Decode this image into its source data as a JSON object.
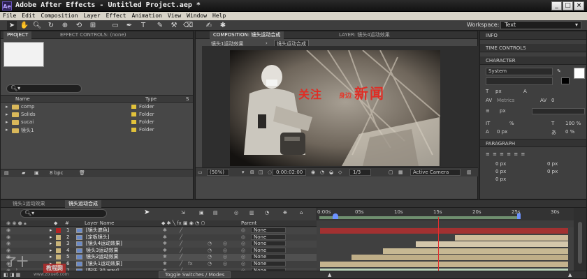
{
  "window": {
    "title": "Adobe After Effects - Untitled Project.aep *",
    "icon_text": "Ae"
  },
  "menu": [
    "File",
    "Edit",
    "Composition",
    "Layer",
    "Effect",
    "Animation",
    "View",
    "Window",
    "Help"
  ],
  "toolbar": {
    "workspace_label": "Workspace:",
    "workspace_value": "Text"
  },
  "project_panel": {
    "tabs": [
      "PROJECT",
      "EFFECT CONTROLS: (none)"
    ],
    "columns": {
      "name": "Name",
      "type": "Type"
    },
    "items": [
      {
        "name": "comp",
        "type": "Folder"
      },
      {
        "name": "Solids",
        "type": "Folder"
      },
      {
        "name": "sucai",
        "type": "Folder"
      },
      {
        "name": "镜头1",
        "type": "Folder"
      }
    ],
    "footer": "8 bpc"
  },
  "composition_panel": {
    "tab": "COMPOSITION: 镜头运动合成",
    "layer_tab": "LAYER: 镜头4运动效果",
    "breadcrumbs": [
      "镜头1运动效果",
      "镜头运动合成"
    ],
    "frame_text": {
      "left": "关注",
      "mid": "身边",
      "right": "新闻"
    },
    "zoom": "(50%)",
    "timecode": "0:00:02:00",
    "resolution": "1/3",
    "camera": "Active Camera"
  },
  "right_panels": {
    "info": "INFO",
    "time_controls": "TIME CONTROLS",
    "character": "CHARACTER",
    "font": "System",
    "metrics": "Metrics",
    "px1": "px",
    "tracking": "0",
    "px2": "px",
    "scale_v": "%",
    "scale_h": "100 %",
    "baseline": "0 px",
    "tsume": "0 %",
    "paragraph": "PARAGRAPH",
    "para_values": [
      "0 px",
      "0 px",
      "0 px",
      "0 px",
      "0 px"
    ]
  },
  "timeline": {
    "tabs": [
      "镜头1运动效果",
      "镜头运动合成"
    ],
    "columns": {
      "num": "#",
      "layer_name": "Layer Name",
      "parent": "Parent"
    },
    "ruler": [
      "0:00s",
      "05s",
      "10s",
      "15s",
      "20s",
      "25s",
      "30s"
    ],
    "layers": [
      {
        "num": "1",
        "name": "[镜头遮色]",
        "parent": "None"
      },
      {
        "num": "2",
        "name": "[定板镜头]",
        "parent": "None"
      },
      {
        "num": "3",
        "name": "[镜头4运动效果]",
        "parent": "None"
      },
      {
        "num": "4",
        "name": "镜头3运动效果",
        "parent": "None"
      },
      {
        "num": "5",
        "name": "镜头2运动效果",
        "parent": "None"
      },
      {
        "num": "6",
        "name": "[镜头1运动效果]",
        "parent": "None"
      },
      {
        "num": "7",
        "name": "[配乐 30.wav]",
        "parent": "None"
      }
    ],
    "toggle_label": "Toggle Switches / Modes"
  },
  "watermark": {
    "left": "了十",
    "right": "教程网",
    "url": "www.zixue6.com"
  },
  "colors": {
    "accent": "#6c92ff",
    "current_time": "#e23030",
    "work_area": "#3f8a3f"
  }
}
